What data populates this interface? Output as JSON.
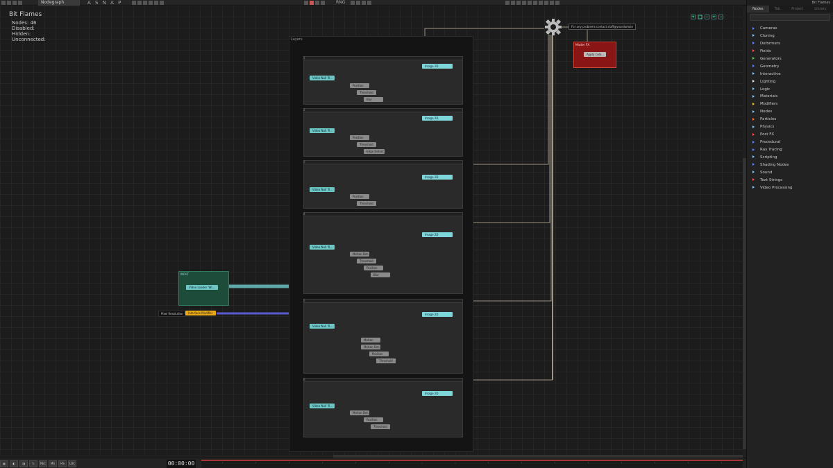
{
  "toolbar": {
    "tab_label": "Nodegraph",
    "snap_label": "A S N A P",
    "record_label": "RNG"
  },
  "stats": {
    "title": "Bit Flames",
    "nodes": "Nodes: 46",
    "disabled": "Disabled:",
    "hidden": "Hidden:",
    "unconnected": "Unconnected:"
  },
  "canvas": {
    "layers_title": "Layers",
    "input_group_title": "INPUT",
    "master_title": "Master FX",
    "master_node": "Apply Colo...",
    "note_text": "For any problems contact staff@yourdomain",
    "pixel_resolution": "Pixel Resolution",
    "video_loader": "Video Loader 'Wi...",
    "interface_modifier": "Interface Modifier",
    "layers": [
      {
        "num": "1",
        "image": "Image 2D",
        "video": "Video Null 'R...",
        "chain": [
          "Position",
          "Threshold",
          "Blur"
        ]
      },
      {
        "num": "2",
        "image": "Image 2D",
        "video": "Video Null 'R...",
        "chain": [
          "Position",
          "Threshold",
          "Edge Detect"
        ]
      },
      {
        "num": "3",
        "image": "Image 2D",
        "video": "Video Null 'R...",
        "chain": [
          "Position",
          "Threshold"
        ]
      },
      {
        "num": "4",
        "image": "Image 2D",
        "video": "Video Null 'R...",
        "chain": [
          "Motion Det...",
          "Threshold",
          "Position",
          "Blur"
        ]
      },
      {
        "num": "5",
        "image": "Image 2D",
        "video": "Video Null 'R...",
        "chain": [
          "Motion",
          "Motion Det...",
          "Position",
          "Threshold"
        ]
      },
      {
        "num": "6",
        "image": "Image 2D",
        "video": "Video Null 'R...",
        "chain": [
          "Motion Det...",
          "Position",
          "Threshold"
        ]
      }
    ]
  },
  "panel": {
    "top_label": "Bit Flames",
    "tabs": [
      "Nodes",
      "Tab",
      "Project",
      "Library"
    ],
    "items": [
      {
        "label": "Cameras",
        "color": "#6b8cff"
      },
      {
        "label": "Cloning",
        "color": "#8fd0ff"
      },
      {
        "label": "Deformers",
        "color": "#6b8cff"
      },
      {
        "label": "Fields",
        "color": "#ff5a5a"
      },
      {
        "label": "Generators",
        "color": "#6ad36a"
      },
      {
        "label": "Geometry",
        "color": "#6b8cff"
      },
      {
        "label": "Interactive",
        "color": "#8fd0ff"
      },
      {
        "label": "Lighting",
        "color": "#ffffff"
      },
      {
        "label": "Logic",
        "color": "#8fd0ff"
      },
      {
        "label": "Materials",
        "color": "#8fd0ff"
      },
      {
        "label": "Modifiers",
        "color": "#f2d04a"
      },
      {
        "label": "Nodes",
        "color": "#8fd0ff"
      },
      {
        "label": "Particles",
        "color": "#ff7a3a"
      },
      {
        "label": "Physics",
        "color": "#8fd0ff"
      },
      {
        "label": "Post FX",
        "color": "#ff5a5a"
      },
      {
        "label": "Procedural",
        "color": "#6b8cff"
      },
      {
        "label": "Ray Tracing",
        "color": "#6b8cff"
      },
      {
        "label": "Scripting",
        "color": "#8fd0ff"
      },
      {
        "label": "Shading Nodes",
        "color": "#6b8cff"
      },
      {
        "label": "Sound",
        "color": "#8fd0ff"
      },
      {
        "label": "Text Strings",
        "color": "#ff5a5a"
      },
      {
        "label": "Video Processing",
        "color": "#8fd0ff"
      }
    ]
  },
  "bottom": {
    "timecode": "00:00:00",
    "buttons": [
      "REC",
      "MS",
      "HS",
      "LOC"
    ]
  }
}
